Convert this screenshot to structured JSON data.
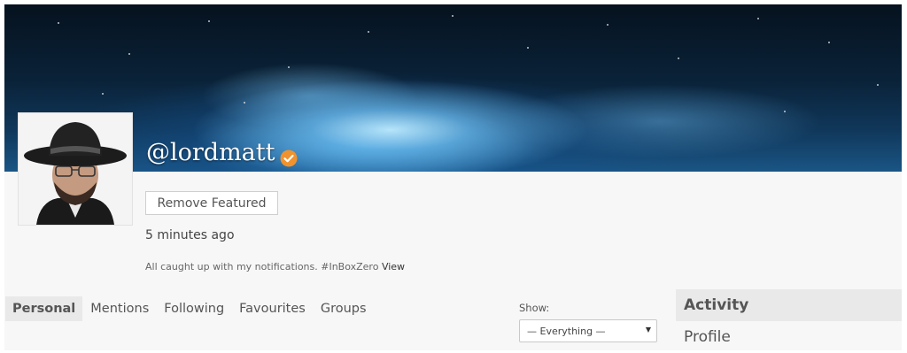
{
  "profile": {
    "handle": "@lordmatt",
    "featured_button": "Remove Featured",
    "timestamp": "5 minutes ago",
    "status_text": "All caught up with my notifications. #InBoxZero",
    "status_link": "View"
  },
  "tabs": [
    {
      "label": "Personal",
      "active": true
    },
    {
      "label": "Mentions"
    },
    {
      "label": "Following"
    },
    {
      "label": "Favourites"
    },
    {
      "label": "Groups"
    }
  ],
  "filter": {
    "label": "Show:",
    "selected": "— Everything —"
  },
  "sidebar": {
    "items": [
      {
        "label": "Activity",
        "active": true
      },
      {
        "label": "Profile"
      }
    ]
  },
  "colors": {
    "verified_badge": "#f0922e",
    "active_tab_bg": "#e9e9e9",
    "page_bg": "#f7f7f7"
  }
}
